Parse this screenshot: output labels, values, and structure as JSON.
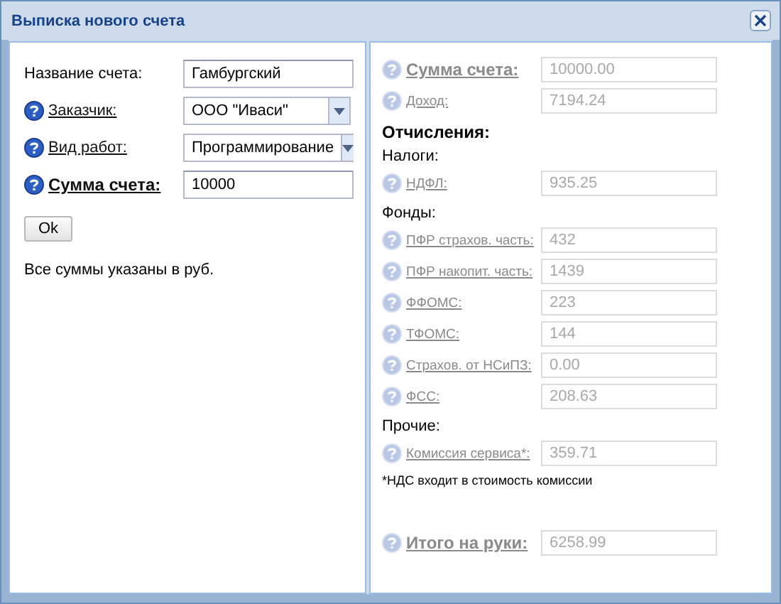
{
  "window": {
    "title": "Выписка нового счета"
  },
  "left": {
    "fields": [
      {
        "kind": "text",
        "label": "Название счета:",
        "help": false,
        "link": false,
        "bold": false,
        "value": "Гамбургский"
      },
      {
        "kind": "select",
        "label": "Заказчик:",
        "help": true,
        "link": true,
        "bold": false,
        "value": "ООО \"Иваси\""
      },
      {
        "kind": "select",
        "label": "Вид работ:",
        "help": true,
        "link": true,
        "bold": false,
        "value": "Программирование"
      },
      {
        "kind": "text",
        "label": "Сумма счета:",
        "help": true,
        "link": true,
        "bold": true,
        "value": "10000"
      }
    ],
    "button": "Ok",
    "note": "Все суммы указаны в руб."
  },
  "right": {
    "items": [
      {
        "kind": "field",
        "label": "Сумма счета:",
        "bold": true,
        "disabled": true,
        "value": "10000.00"
      },
      {
        "kind": "field",
        "label": "Доход:",
        "bold": false,
        "disabled": true,
        "value": "7194.24"
      },
      {
        "kind": "heading",
        "text": "Отчисления:"
      },
      {
        "kind": "subheading",
        "text": "Налоги:"
      },
      {
        "kind": "field",
        "label": "НДФЛ:",
        "bold": false,
        "disabled": true,
        "value": "935.25"
      },
      {
        "kind": "subheading",
        "text": "Фонды:"
      },
      {
        "kind": "field",
        "label": "ПФР страхов. часть:",
        "bold": false,
        "disabled": true,
        "value": "432"
      },
      {
        "kind": "field",
        "label": "ПФР накопит. часть:",
        "bold": false,
        "disabled": true,
        "value": "1439"
      },
      {
        "kind": "field",
        "label": "ФФОМС:",
        "bold": false,
        "disabled": true,
        "value": "223"
      },
      {
        "kind": "field",
        "label": "ТФОМС:",
        "bold": false,
        "disabled": true,
        "value": "144"
      },
      {
        "kind": "field",
        "label": "Страхов. от НСиПЗ:",
        "bold": false,
        "disabled": true,
        "value": "0.00"
      },
      {
        "kind": "field",
        "label": "ФСС:",
        "bold": false,
        "disabled": true,
        "value": "208.63"
      },
      {
        "kind": "subheading",
        "text": "Прочие:"
      },
      {
        "kind": "field",
        "label": "Комиссия сервиса*:",
        "bold": false,
        "disabled": true,
        "value": "359.71"
      },
      {
        "kind": "note",
        "text": "*НДС входит в стоимость комиссии"
      },
      {
        "kind": "total",
        "label": "Итого на руки:",
        "bold": true,
        "disabled": true,
        "value": "6258.99"
      }
    ]
  }
}
